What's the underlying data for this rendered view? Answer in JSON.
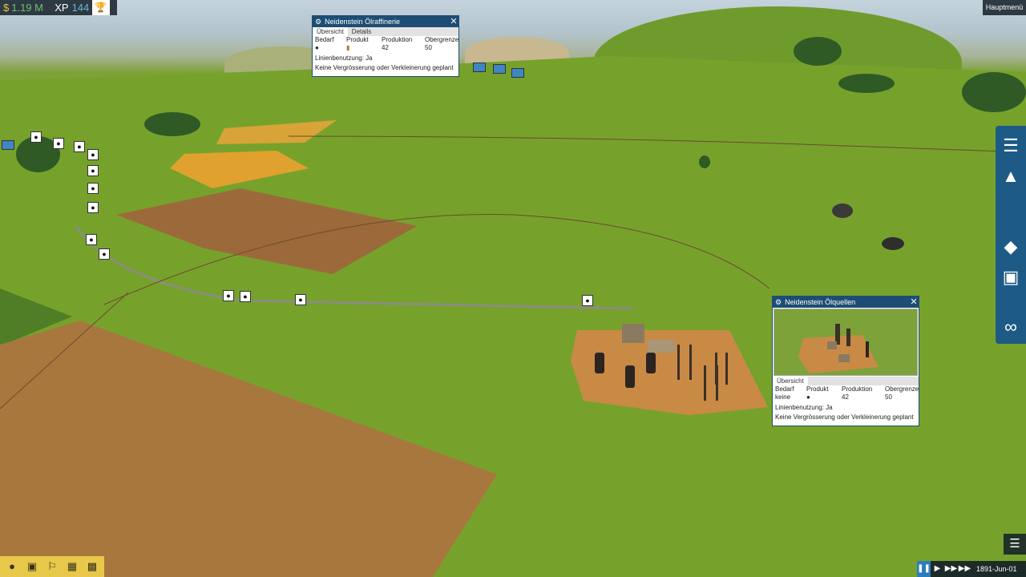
{
  "hud": {
    "currency_symbol": "$",
    "money": "1.19 M",
    "xp_label": "XP",
    "xp_value": "144",
    "trophy_icon": "trophy-icon"
  },
  "main_menu_label": "Hauptmenü",
  "refinery_panel": {
    "title": "Neidenstein Ölraffinerie",
    "tabs": [
      "Übersicht",
      "Details"
    ],
    "columns": [
      "Bedarf",
      "Produkt",
      "Produktion",
      "Obergrenze"
    ],
    "row": {
      "bedarf_icon": "oil-drop-icon",
      "produkt_icon": "fuel-barrel-icon",
      "produktion": "42",
      "obergrenze": "50"
    },
    "line_usage": "Linienbenutzung: Ja",
    "plan": "Keine Vergrösserung oder Verkleinerung geplant"
  },
  "oilwell_panel": {
    "title": "Neidenstein Ölquellen",
    "tabs": [
      "Übersicht"
    ],
    "columns": [
      "Bedarf",
      "Produkt",
      "Produktion",
      "Obergrenze"
    ],
    "row": {
      "bedarf": "keine",
      "produkt_icon": "oil-drop-icon",
      "produktion": "42",
      "obergrenze": "50"
    },
    "line_usage": "Linienbenutzung: Ja",
    "plan": "Keine Vergrösserung oder Verkleinerung geplant"
  },
  "side_toolbar": [
    "rail-icon",
    "road-icon",
    "terrain-icon",
    "vehicle-depot-icon",
    "line-manager-icon"
  ],
  "bottom_left_icons": [
    "money-icon",
    "vehicles-icon",
    "stations-icon",
    "towns-icon",
    "industries-icon"
  ],
  "speed_controls": [
    "pause-icon",
    "play-icon",
    "fast-forward-icon",
    "fastest-forward-icon"
  ],
  "date": "1891-Jun-01",
  "colors": {
    "panel_header": "#1d4d74",
    "toolbar": "#1d5a86",
    "money_green": "#6fc26b",
    "bottom_left_bar": "#e8c84a"
  }
}
